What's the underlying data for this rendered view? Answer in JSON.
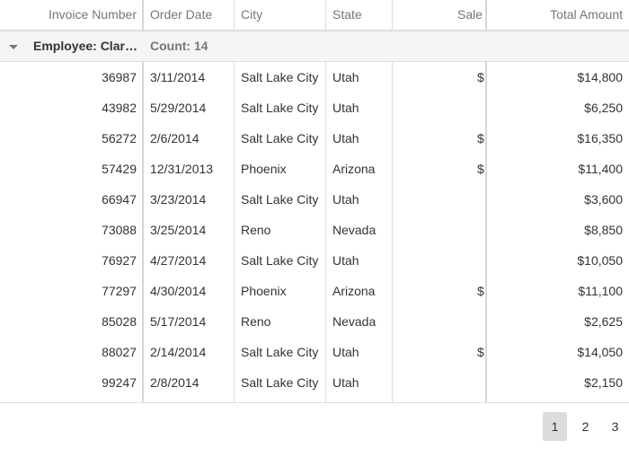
{
  "columns": {
    "invoice_number": "Invoice Number",
    "order_date": "Order Date",
    "city": "City",
    "state": "State",
    "sale": "Sale",
    "total_amount": "Total Amount"
  },
  "group": {
    "title": "Employee: Clark Morgan",
    "count_label": "Count: 14"
  },
  "rows": [
    {
      "invoice": "36987",
      "date": "3/11/2014",
      "city": "Salt Lake City",
      "state": "Utah",
      "sale": "$",
      "total": "$14,800"
    },
    {
      "invoice": "43982",
      "date": "5/29/2014",
      "city": "Salt Lake City",
      "state": "Utah",
      "sale": "",
      "total": "$6,250"
    },
    {
      "invoice": "56272",
      "date": "2/6/2014",
      "city": "Salt Lake City",
      "state": "Utah",
      "sale": "$",
      "total": "$16,350"
    },
    {
      "invoice": "57429",
      "date": "12/31/2013",
      "city": "Phoenix",
      "state": "Arizona",
      "sale": "$",
      "total": "$11,400"
    },
    {
      "invoice": "66947",
      "date": "3/23/2014",
      "city": "Salt Lake City",
      "state": "Utah",
      "sale": "",
      "total": "$3,600"
    },
    {
      "invoice": "73088",
      "date": "3/25/2014",
      "city": "Reno",
      "state": "Nevada",
      "sale": "",
      "total": "$8,850"
    },
    {
      "invoice": "76927",
      "date": "4/27/2014",
      "city": "Salt Lake City",
      "state": "Utah",
      "sale": "",
      "total": "$10,050"
    },
    {
      "invoice": "77297",
      "date": "4/30/2014",
      "city": "Phoenix",
      "state": "Arizona",
      "sale": "$",
      "total": "$11,100"
    },
    {
      "invoice": "85028",
      "date": "5/17/2014",
      "city": "Reno",
      "state": "Nevada",
      "sale": "",
      "total": "$2,625"
    },
    {
      "invoice": "88027",
      "date": "2/14/2014",
      "city": "Salt Lake City",
      "state": "Utah",
      "sale": "$",
      "total": "$14,050"
    },
    {
      "invoice": "99247",
      "date": "2/8/2014",
      "city": "Salt Lake City",
      "state": "Utah",
      "sale": "",
      "total": "$2,150"
    }
  ],
  "pager": {
    "pages": [
      "1",
      "2",
      "3"
    ],
    "current": "1"
  },
  "colors": {
    "grid_line": "#dddddd",
    "header_text": "#767676",
    "group_background": "#f5f5f5",
    "active_page": "#dddddd"
  }
}
